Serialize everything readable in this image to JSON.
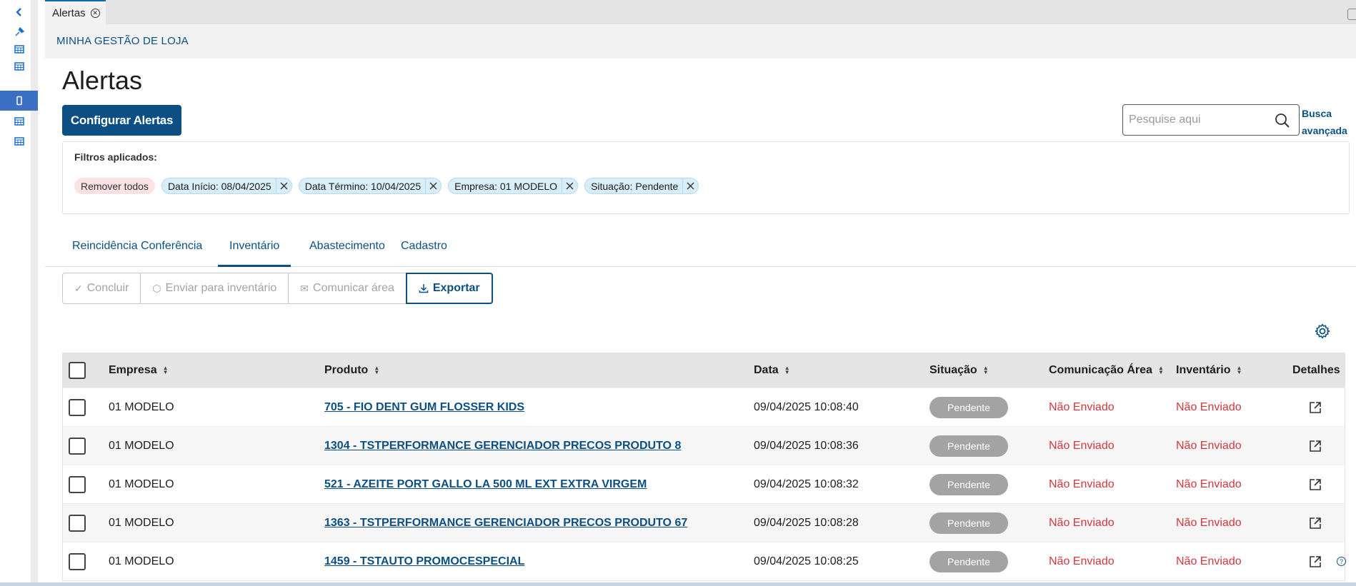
{
  "window": {
    "tab_title": "Alertas"
  },
  "breadcrumb": "MINHA GESTÃO DE LOJA",
  "page_title": "Alertas",
  "config_button": "Configurar Alertas",
  "search": {
    "placeholder": "Pesquise aqui",
    "advanced_line1": "Busca",
    "advanced_line2": "avançada"
  },
  "filters": {
    "label": "Filtros aplicados:",
    "remove_all": "Remover todos",
    "chips": [
      "Data Início: 08/04/2025",
      "Data Término: 10/04/2025",
      "Empresa: 01 MODELO",
      "Situação: Pendente"
    ]
  },
  "tabs": [
    "Reincidência Conferência",
    "Inventário",
    "Abastecimento",
    "Cadastro"
  ],
  "active_tab": "Inventário",
  "actions": [
    "Concluir",
    "Enviar para inventário",
    "Comunicar área",
    "Exportar"
  ],
  "table": {
    "columns": [
      "Empresa",
      "Produto",
      "Data",
      "Situação",
      "Comunicação Área",
      "Inventário",
      "Detalhes"
    ],
    "rows": [
      {
        "empresa": "01 MODELO",
        "produto": "705 - FIO DENT GUM FLOSSER KIDS",
        "data": "09/04/2025 10:08:40",
        "situacao": "Pendente",
        "comunicacao": "Não Enviado",
        "inventario": "Não Enviado"
      },
      {
        "empresa": "01 MODELO",
        "produto": "1304 - TSTPERFORMANCE GERENCIADOR PRECOS PRODUTO 8",
        "data": "09/04/2025 10:08:36",
        "situacao": "Pendente",
        "comunicacao": "Não Enviado",
        "inventario": "Não Enviado"
      },
      {
        "empresa": "01 MODELO",
        "produto": "521 - AZEITE PORT GALLO LA 500 ML EXT EXTRA VIRGEM",
        "data": "09/04/2025 10:08:32",
        "situacao": "Pendente",
        "comunicacao": "Não Enviado",
        "inventario": "Não Enviado"
      },
      {
        "empresa": "01 MODELO",
        "produto": "1363 - TSTPERFORMANCE GERENCIADOR PRECOS PRODUTO 67",
        "data": "09/04/2025 10:08:28",
        "situacao": "Pendente",
        "comunicacao": "Não Enviado",
        "inventario": "Não Enviado"
      },
      {
        "empresa": "01 MODELO",
        "produto": "1459 - TSTAUTO PROMOCESPECIAL",
        "data": "09/04/2025 10:08:25",
        "situacao": "Pendente",
        "comunicacao": "Não Enviado",
        "inventario": "Não Enviado"
      }
    ]
  },
  "sidebar": {
    "items": [
      {
        "icon": "chevron-left-icon"
      },
      {
        "icon": "pin-icon"
      },
      {
        "icon": "table-icon"
      },
      {
        "icon": "table-icon"
      },
      {
        "icon": "mobile-icon",
        "active": true
      },
      {
        "icon": "table-icon"
      },
      {
        "icon": "table-icon"
      }
    ]
  },
  "colors": {
    "primary": "#0c4f85",
    "danger": "#d6363d",
    "pill": "#a3a3a3",
    "sidebar_active": "#3a6fc4"
  }
}
